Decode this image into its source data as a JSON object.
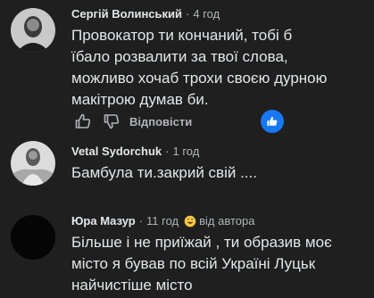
{
  "comments": [
    {
      "author": "Сергій Волинський",
      "time": "4 год",
      "text_lines": [
        "Провокатор ти кончаний, тобі б",
        "їбало розвалити за твої слова,",
        "можливо хочаб трохи своєю дурною",
        "макітрою думав би."
      ],
      "reply_label": "Відповісти",
      "reaction_icon": "like-icon",
      "accent_color": "#1877f2"
    },
    {
      "author": "Vetal Sydorchuk",
      "time": "1 год",
      "text_lines": [
        "Бамбула ти.закрий свій ...."
      ]
    },
    {
      "author": "Юра Мазур",
      "time": "11 год",
      "badge_icon": "grinning-sweat-emoji-icon",
      "badge_text": "від автора",
      "text_lines": [
        "Більше і не приїжай , ти образив моє",
        "місто я бував по всій Україні Луцьк",
        "найчистіше місто"
      ]
    }
  ]
}
